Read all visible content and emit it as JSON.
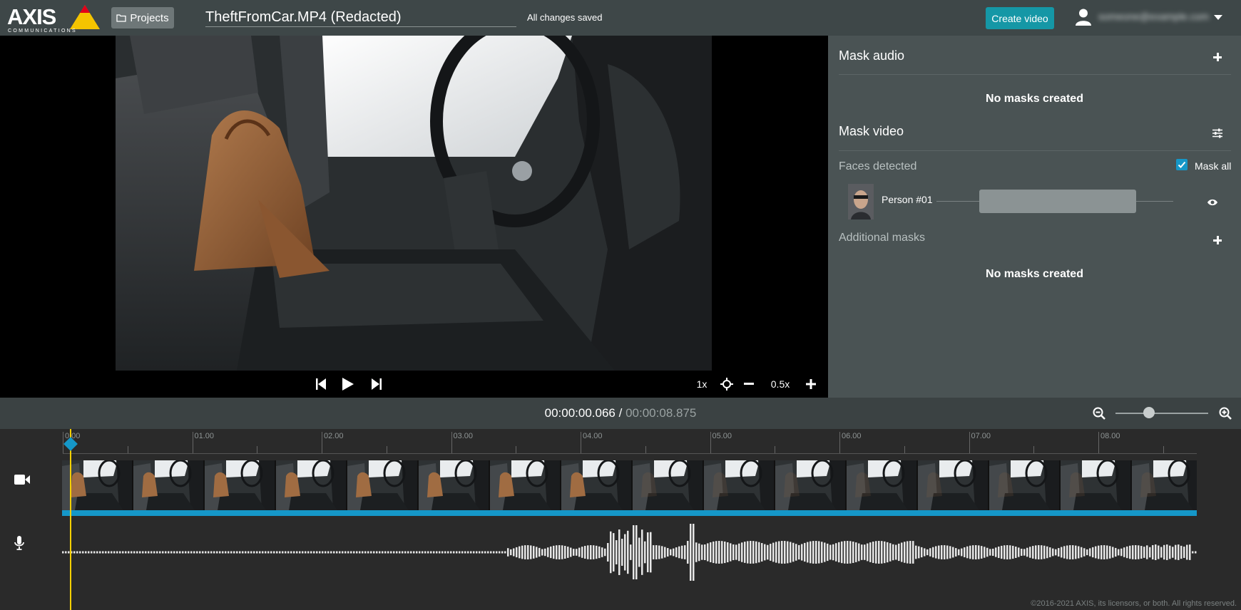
{
  "header": {
    "logo_text": "AXIS",
    "logo_sub": "COMMUNICATIONS",
    "projects_label": "Projects",
    "title": "TheftFromCar.MP4 (Redacted)",
    "save_status": "All changes saved",
    "create_label": "Create video",
    "user_email": "someone@example.com"
  },
  "player": {
    "speed": "1x",
    "zoom": "0.5x"
  },
  "panel": {
    "mask_audio_title": "Mask audio",
    "audio_empty": "No masks created",
    "mask_video_title": "Mask video",
    "faces_label": "Faces detected",
    "mask_all_label": "Mask all",
    "mask_all_checked": true,
    "person_label": "Person #01",
    "additional_label": "Additional masks",
    "additional_empty": "No masks created"
  },
  "time": {
    "current": "00:00:00.066",
    "separator": "/",
    "total": "00:00:08.875"
  },
  "ruler": [
    "0.00",
    "01.00",
    "02.00",
    "03.00",
    "04.00",
    "05.00",
    "06.00",
    "07.00",
    "08.00"
  ],
  "footer": {
    "copyright": "©2016-2021 AXIS, its licensors, or both. All rights reserved."
  },
  "colors": {
    "accent": "#1597a6",
    "strip_bar": "#1597c8",
    "playhead": "#f5d000",
    "panel_bg": "#4a5354",
    "topbar_bg": "#3e4748"
  }
}
